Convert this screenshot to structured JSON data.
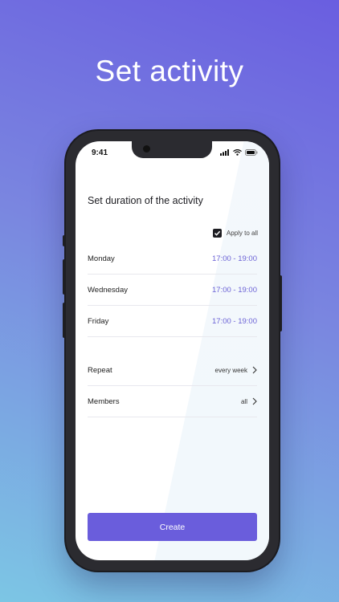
{
  "hero": {
    "title": "Set activity"
  },
  "status_bar": {
    "time": "9:41"
  },
  "screen": {
    "heading": "Set duration of the activity",
    "apply_to_all": {
      "label": "Apply to all",
      "checked": true
    },
    "days": [
      {
        "day": "Monday",
        "time": "17:00 - 19:00"
      },
      {
        "day": "Wednesday",
        "time": "17:00 - 19:00"
      },
      {
        "day": "Friday",
        "time": "17:00 - 19:00"
      }
    ],
    "settings": [
      {
        "label": "Repeat",
        "value": "every week"
      },
      {
        "label": "Members",
        "value": "all"
      }
    ],
    "create_label": "Create"
  },
  "colors": {
    "accent": "#6a5ddc",
    "time_text": "#6c63d6"
  },
  "icons": [
    "check-icon",
    "chevron-right-icon",
    "signal-icon",
    "wifi-icon",
    "battery-icon"
  ]
}
